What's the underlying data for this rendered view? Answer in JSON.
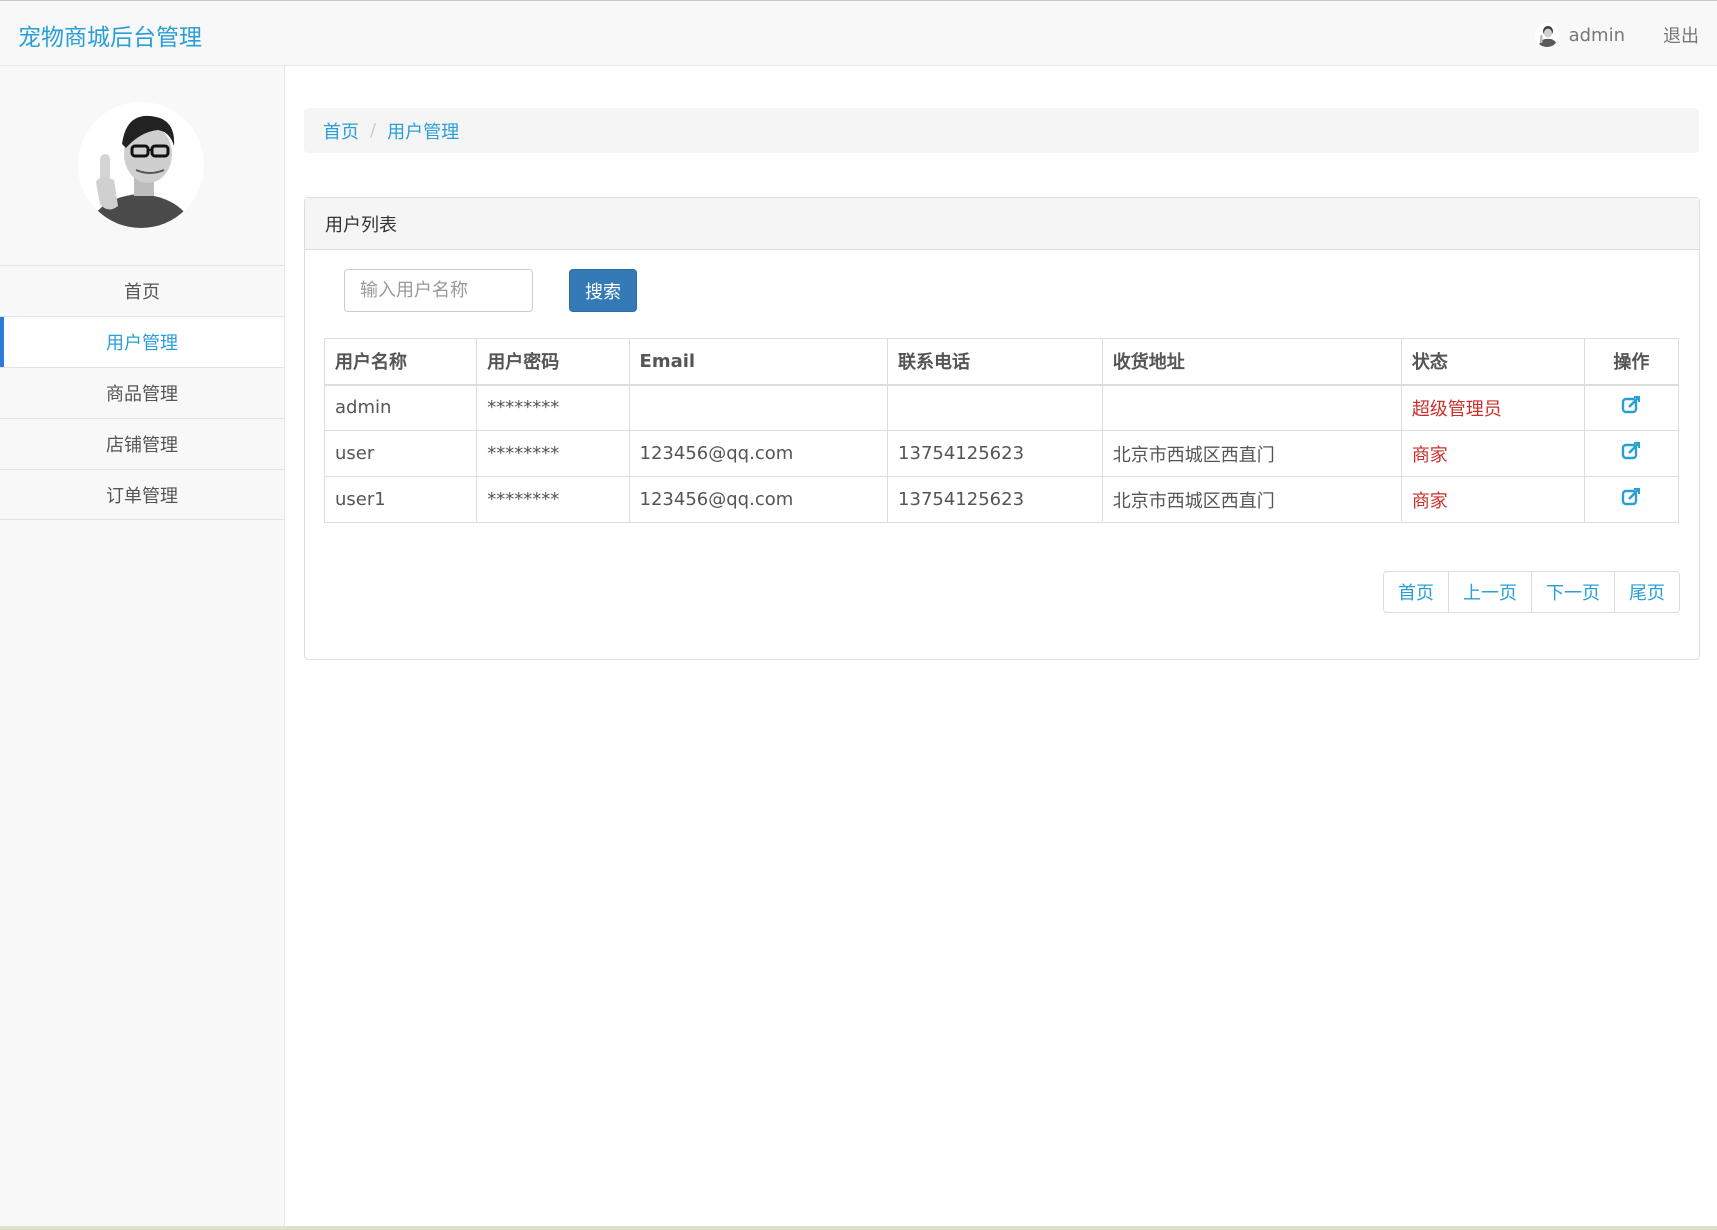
{
  "header": {
    "brand": "宠物商城后台管理",
    "username": "admin",
    "logout": "退出"
  },
  "sidebar": {
    "items": [
      {
        "label": "首页"
      },
      {
        "label": "用户管理"
      },
      {
        "label": "商品管理"
      },
      {
        "label": "店铺管理"
      },
      {
        "label": "订单管理"
      }
    ]
  },
  "breadcrumb": {
    "home": "首页",
    "current": "用户管理",
    "separator": "/"
  },
  "panel": {
    "title": "用户列表",
    "search_placeholder": "输入用户名称",
    "search_button": "搜索"
  },
  "table": {
    "columns": [
      "用户名称",
      "用户密码",
      "Email",
      "联系电话",
      "收货地址",
      "状态",
      "操作"
    ],
    "rows": [
      {
        "name": "admin",
        "password": "********",
        "email": "",
        "phone": "",
        "address": "",
        "role": "超级管理员"
      },
      {
        "name": "user",
        "password": "********",
        "email": "123456@qq.com",
        "phone": "13754125623",
        "address": "北京市西城区西直门",
        "role": "商家"
      },
      {
        "name": "user1",
        "password": "********",
        "email": "123456@qq.com",
        "phone": "13754125623",
        "address": "北京市西城区西直门",
        "role": "商家"
      }
    ]
  },
  "pager": {
    "first": "首页",
    "prev": "上一页",
    "next": "下一页",
    "last": "尾页"
  },
  "colors": {
    "accent": "#2a9fd6",
    "primary_button": "#337ab7",
    "role_text": "#c9302c"
  },
  "icons": {
    "edit": "edit-icon",
    "avatar": "avatar"
  }
}
